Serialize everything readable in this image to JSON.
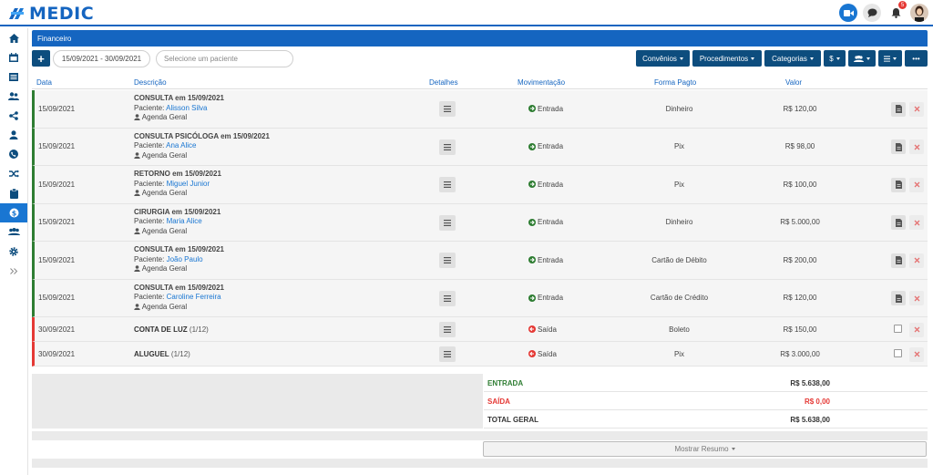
{
  "app": {
    "logo_text": "MEDIC",
    "notification_count": "5"
  },
  "panel": {
    "title": "Financeiro"
  },
  "toolbar": {
    "add_label": "+",
    "date_range": "15/09/2021 - 30/09/2021",
    "patient_placeholder": "Selecione um paciente",
    "buttons": [
      {
        "label": "Convênios"
      },
      {
        "label": "Procedimentos"
      },
      {
        "label": "Categorias"
      },
      {
        "label": "$"
      },
      {
        "label": ""
      },
      {
        "label": ""
      },
      {
        "label": "•••"
      }
    ]
  },
  "table": {
    "headers": {
      "data": "Data",
      "descricao": "Descrição",
      "detalhes": "Detalhes",
      "movimentacao": "Movimentação",
      "forma": "Forma Pagto",
      "valor": "Valor"
    },
    "patient_prefix": "Paciente:",
    "rows": [
      {
        "date": "15/09/2021",
        "title": "CONSULTA em 15/09/2021",
        "patient": "Alisson Silva",
        "agenda": "Agenda Geral",
        "mov": "Entrada",
        "type": "in",
        "forma": "Dinheiro",
        "valor": "R$ 120,00"
      },
      {
        "date": "15/09/2021",
        "title": "CONSULTA PSICÓLOGA em 15/09/2021",
        "patient": "Ana Alice",
        "agenda": "Agenda Geral",
        "mov": "Entrada",
        "type": "in",
        "forma": "Pix",
        "valor": "R$ 98,00"
      },
      {
        "date": "15/09/2021",
        "title": "RETORNO em 15/09/2021",
        "patient": "Miguel Junior",
        "agenda": "Agenda Geral",
        "mov": "Entrada",
        "type": "in",
        "forma": "Pix",
        "valor": "R$ 100,00"
      },
      {
        "date": "15/09/2021",
        "title": "CIRURGIA em 15/09/2021",
        "patient": "Maria Alice",
        "agenda": "Agenda Geral",
        "mov": "Entrada",
        "type": "in",
        "forma": "Dinheiro",
        "valor": "R$ 5.000,00"
      },
      {
        "date": "15/09/2021",
        "title": "CONSULTA em 15/09/2021",
        "patient": "João Paulo",
        "agenda": "Agenda Geral",
        "mov": "Entrada",
        "type": "in",
        "forma": "Cartão de Débito",
        "valor": "R$ 200,00"
      },
      {
        "date": "15/09/2021",
        "title": "CONSULTA em 15/09/2021",
        "patient": "Caroline Ferreira",
        "agenda": "Agenda Geral",
        "mov": "Entrada",
        "type": "in",
        "forma": "Cartão de Crédito",
        "valor": "R$ 120,00"
      },
      {
        "date": "30/09/2021",
        "title": "CONTA DE LUZ",
        "count": "(1/12)",
        "mov": "Saída",
        "type": "out",
        "forma": "Boleto",
        "valor": "R$ 150,00"
      },
      {
        "date": "30/09/2021",
        "title": "ALUGUEL",
        "count": "(1/12)",
        "mov": "Saída",
        "type": "out",
        "forma": "Pix",
        "valor": "R$ 3.000,00"
      }
    ]
  },
  "summary": {
    "entrada_label": "ENTRADA",
    "entrada_value": "R$ 5.638,00",
    "saida_label": "SAÍDA",
    "saida_value": "R$ 0,00",
    "total_label": "TOTAL GERAL",
    "total_value": "R$ 5.638,00",
    "resumo_label": "Mostrar Resumo"
  },
  "colors": {
    "primary": "#1565c0",
    "dark_button": "#0d4d7e",
    "entrada": "#2e7d32",
    "saida": "#e53935"
  }
}
